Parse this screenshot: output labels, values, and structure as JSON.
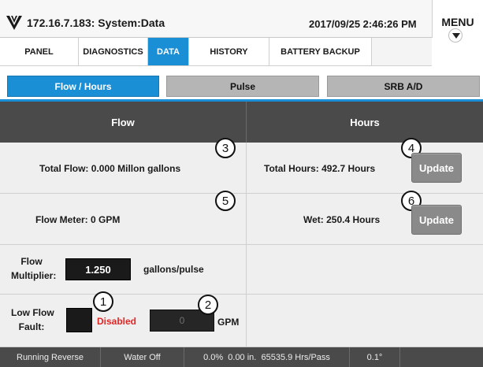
{
  "header": {
    "title": "172.16.7.183: System:Data",
    "datetime": "2017/09/25 2:46:26 PM",
    "menu_label": "MENU"
  },
  "nav_tabs": [
    {
      "label": "PANEL",
      "active": false
    },
    {
      "label": "DIAGNOSTICS",
      "active": false
    },
    {
      "label": "DATA",
      "active": true
    },
    {
      "label": "HISTORY",
      "active": false
    },
    {
      "label": "BATTERY BACKUP",
      "active": false
    }
  ],
  "sub_tabs": [
    {
      "label": "Flow / Hours",
      "active": true
    },
    {
      "label": "Pulse",
      "active": false
    },
    {
      "label": "SRB A/D",
      "active": false
    }
  ],
  "sections": {
    "flow_header": "Flow",
    "hours_header": "Hours"
  },
  "flow": {
    "total_flow": "Total Flow: 0.000 Millon gallons",
    "flow_meter": "Flow Meter: 0 GPM",
    "multiplier_label_1": "Flow",
    "multiplier_label_2": "Multiplier:",
    "multiplier_value": "1.250",
    "multiplier_unit": "gallons/pulse",
    "low_flow_label_1": "Low Flow",
    "low_flow_label_2": "Fault:",
    "low_flow_status": "Disabled",
    "low_flow_value": "0",
    "low_flow_unit": "GPM"
  },
  "hours": {
    "total_hours": "Total Hours: 492.7 Hours",
    "wet_hours": "Wet: 250.4 Hours",
    "update_label": "Update"
  },
  "callouts": [
    "1",
    "2",
    "3",
    "4",
    "5",
    "6"
  ],
  "status_bar": {
    "direction": "Running Reverse",
    "water": "Water Off",
    "percent": "0.0%",
    "depth": "0.00 in.",
    "pass_rate": "65535.9 Hrs/Pass",
    "angle": "0.1°"
  },
  "colors": {
    "accent": "#1b8fd6",
    "header_dark": "#4a4a4a",
    "disabled_red": "#e12626",
    "button_gray": "#8a8a8a"
  }
}
